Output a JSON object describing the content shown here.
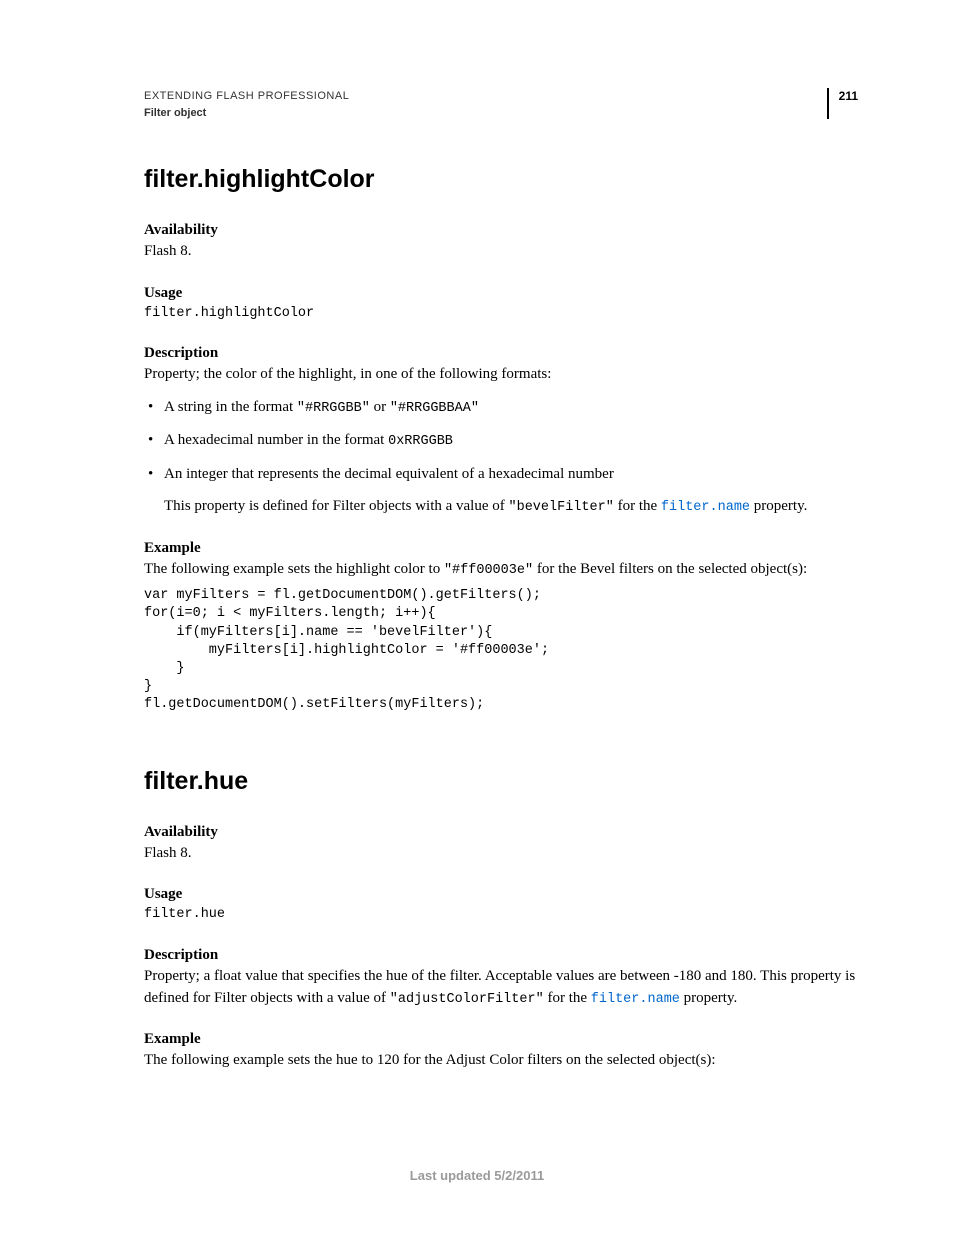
{
  "header": {
    "breadcrumb": "EXTENDING FLASH PROFESSIONAL",
    "section": "Filter object",
    "page_number": "211"
  },
  "section1": {
    "title": "filter.highlightColor",
    "availability_label": "Availability",
    "availability_text": "Flash 8.",
    "usage_label": "Usage",
    "usage_code": "filter.highlightColor",
    "description_label": "Description",
    "description_text": "Property; the color of the highlight, in one of the following formats:",
    "bullet1_pre": "A string in the format ",
    "bullet1_code1": "\"#RRGGBB\"",
    "bullet1_mid": " or ",
    "bullet1_code2": "\"#RRGGBBAA\"",
    "bullet2_pre": "A hexadecimal number in the format ",
    "bullet2_code": "0xRRGGBB",
    "bullet3": "An integer that represents the decimal equivalent of a hexadecimal number",
    "after_bullets_pre": "This property is defined for Filter objects with a value of ",
    "after_bullets_code": "\"bevelFilter\"",
    "after_bullets_mid": " for the ",
    "after_bullets_link": "filter.name",
    "after_bullets_post": " property.",
    "example_label": "Example",
    "example_text_pre": "The following example sets the highlight color to ",
    "example_text_code": "\"#ff00003e\"",
    "example_text_post": " for the Bevel filters on the selected object(s):",
    "example_code": "var myFilters = fl.getDocumentDOM().getFilters();\nfor(i=0; i < myFilters.length; i++){\n    if(myFilters[i].name == 'bevelFilter'){\n        myFilters[i].highlightColor = '#ff00003e';\n    }\n}\nfl.getDocumentDOM().setFilters(myFilters);"
  },
  "section2": {
    "title": "filter.hue",
    "availability_label": "Availability",
    "availability_text": "Flash 8.",
    "usage_label": "Usage",
    "usage_code": "filter.hue",
    "description_label": "Description",
    "description_text_pre": "Property; a float value that specifies the hue of the filter. Acceptable values are between -180 and 180. This property is defined for Filter objects with a value of ",
    "description_code": "\"adjustColorFilter\"",
    "description_mid": " for the ",
    "description_link": "filter.name",
    "description_post": " property.",
    "example_label": "Example",
    "example_text": "The following example sets the hue to 120 for the Adjust Color filters on the selected object(s):"
  },
  "footer": {
    "text": "Last updated 5/2/2011"
  }
}
